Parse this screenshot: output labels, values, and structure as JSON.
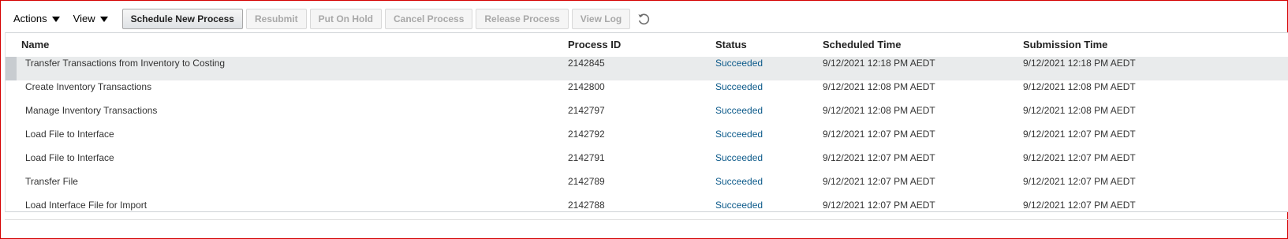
{
  "toolbar": {
    "menus": [
      {
        "label": "Actions"
      },
      {
        "label": "View"
      }
    ],
    "buttons": {
      "schedule": "Schedule New Process",
      "resubmit": "Resubmit",
      "hold": "Put On Hold",
      "cancel": "Cancel Process",
      "release": "Release Process",
      "viewlog": "View Log"
    },
    "refresh_icon": "refresh-icon"
  },
  "table": {
    "columns": {
      "name": "Name",
      "process_id": "Process ID",
      "status": "Status",
      "scheduled": "Scheduled Time",
      "submission": "Submission Time"
    },
    "rows": [
      {
        "name": "Transfer Transactions from Inventory to Costing",
        "process_id": "2142845",
        "status": "Succeeded",
        "scheduled": "9/12/2021 12:18 PM AEDT",
        "submission": "9/12/2021 12:18 PM AEDT"
      },
      {
        "name": "Create Inventory Transactions",
        "process_id": "2142800",
        "status": "Succeeded",
        "scheduled": "9/12/2021 12:08 PM AEDT",
        "submission": "9/12/2021 12:08 PM AEDT"
      },
      {
        "name": "Manage Inventory Transactions",
        "process_id": "2142797",
        "status": "Succeeded",
        "scheduled": "9/12/2021 12:08 PM AEDT",
        "submission": "9/12/2021 12:08 PM AEDT"
      },
      {
        "name": "Load File to Interface",
        "process_id": "2142792",
        "status": "Succeeded",
        "scheduled": "9/12/2021 12:07 PM AEDT",
        "submission": "9/12/2021 12:07 PM AEDT"
      },
      {
        "name": "Load File to Interface",
        "process_id": "2142791",
        "status": "Succeeded",
        "scheduled": "9/12/2021 12:07 PM AEDT",
        "submission": "9/12/2021 12:07 PM AEDT"
      },
      {
        "name": "Transfer File",
        "process_id": "2142789",
        "status": "Succeeded",
        "scheduled": "9/12/2021 12:07 PM AEDT",
        "submission": "9/12/2021 12:07 PM AEDT"
      },
      {
        "name": "Load Interface File for Import",
        "process_id": "2142788",
        "status": "Succeeded",
        "scheduled": "9/12/2021 12:07 PM AEDT",
        "submission": "9/12/2021 12:07 PM AEDT"
      }
    ]
  },
  "colors": {
    "status_link": "#0c5a8a",
    "selected_row": "#e9ebec",
    "frame_border": "#d40000"
  }
}
